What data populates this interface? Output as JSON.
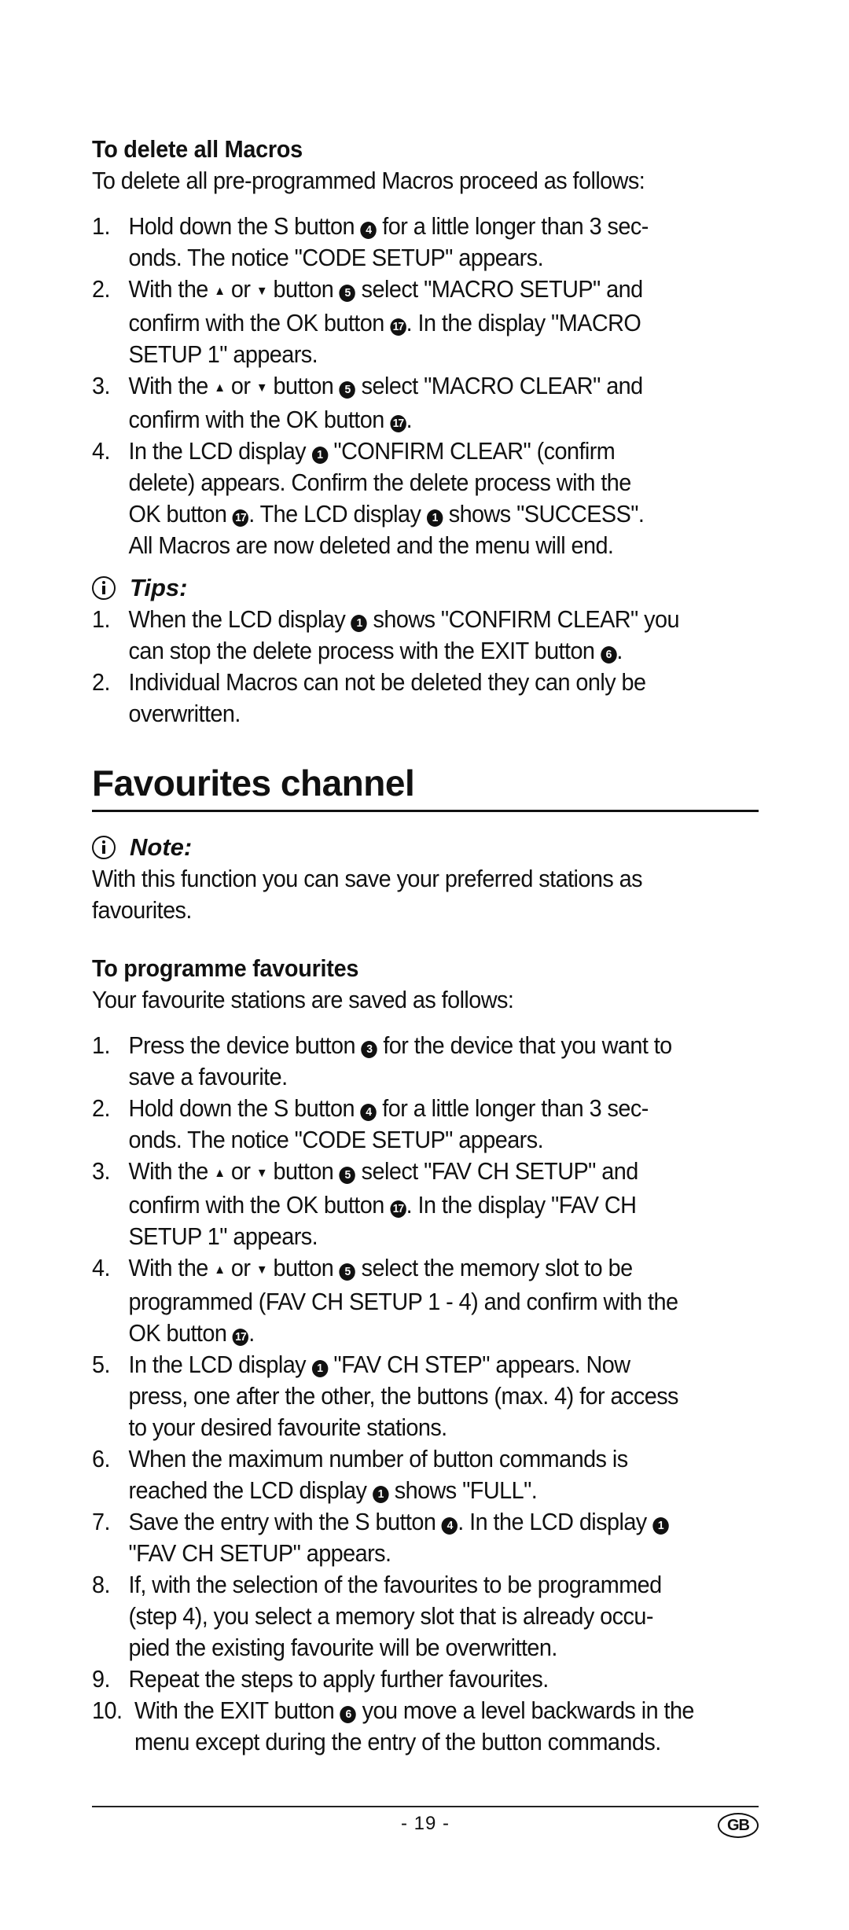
{
  "delete_macros": {
    "heading": "To delete all Macros",
    "intro": "To delete all pre-programmed Macros proceed as follows:",
    "steps": [
      {
        "num": "1.",
        "lines": [
          [
            {
              "t": "Hold down the S button "
            },
            {
              "b": "4"
            },
            {
              "t": " for a little longer than 3 sec-"
            }
          ],
          [
            {
              "t": "onds. The notice \"CODE SETUP\" appears."
            }
          ]
        ]
      },
      {
        "num": "2.",
        "lines": [
          [
            {
              "t": "With the "
            },
            {
              "a": "up"
            },
            {
              "t": " or "
            },
            {
              "a": "down"
            },
            {
              "t": " button "
            },
            {
              "b": "5"
            },
            {
              "t": " select \"MACRO SETUP\" and"
            }
          ],
          [
            {
              "t": "confirm with the OK button "
            },
            {
              "b": "17"
            },
            {
              "t": ". In the display \"MACRO"
            }
          ],
          [
            {
              "t": "SETUP 1\" appears."
            }
          ]
        ]
      },
      {
        "num": "3.",
        "lines": [
          [
            {
              "t": "With the "
            },
            {
              "a": "up"
            },
            {
              "t": " or "
            },
            {
              "a": "down"
            },
            {
              "t": " button "
            },
            {
              "b": "5"
            },
            {
              "t": " select \"MACRO CLEAR\" and"
            }
          ],
          [
            {
              "t": "confirm with the OK button "
            },
            {
              "b": "17"
            },
            {
              "t": "."
            }
          ]
        ]
      },
      {
        "num": "4.",
        "lines": [
          [
            {
              "t": "In the LCD display "
            },
            {
              "b": "1"
            },
            {
              "t": " \"CONFIRM CLEAR\" (confirm"
            }
          ],
          [
            {
              "t": "delete) appears. Confirm the delete process with the"
            }
          ],
          [
            {
              "t": "OK button "
            },
            {
              "b": "17"
            },
            {
              "t": ".  The LCD display "
            },
            {
              "b": "1"
            },
            {
              "t": " shows \"SUCCESS\"."
            }
          ],
          [
            {
              "t": "All Macros are now deleted and the menu will end."
            }
          ]
        ]
      }
    ]
  },
  "tips": {
    "icon": "info-icon",
    "label": "Tips:",
    "steps": [
      {
        "num": "1.",
        "lines": [
          [
            {
              "t": "When the LCD display "
            },
            {
              "b": "1"
            },
            {
              "t": " shows \"CONFIRM CLEAR\" you"
            }
          ],
          [
            {
              "t": "can stop the delete process with the EXIT button "
            },
            {
              "b": "6"
            },
            {
              "t": "."
            }
          ]
        ]
      },
      {
        "num": "2.",
        "lines": [
          [
            {
              "t": "Individual Macros can not be deleted they can only be"
            }
          ],
          [
            {
              "t": "overwritten."
            }
          ]
        ]
      }
    ]
  },
  "favourites": {
    "title": "Favourites channel",
    "note": {
      "icon": "info-icon",
      "label": "Note:",
      "lines": [
        "With this function you can save your preferred stations as",
        "favourites."
      ]
    },
    "programme": {
      "heading": "To programme favourites",
      "intro": "Your favourite stations are saved as follows:",
      "steps": [
        {
          "num": "1.",
          "lines": [
            [
              {
                "t": "Press the device button "
              },
              {
                "b": "3"
              },
              {
                "t": " for the device that you want to"
              }
            ],
            [
              {
                "t": "save a favourite."
              }
            ]
          ]
        },
        {
          "num": "2.",
          "lines": [
            [
              {
                "t": "Hold down the S button "
              },
              {
                "b": "4"
              },
              {
                "t": " for a little longer than 3 sec-"
              }
            ],
            [
              {
                "t": "onds. The notice \"CODE SETUP\" appears."
              }
            ]
          ]
        },
        {
          "num": "3.",
          "lines": [
            [
              {
                "t": "With the "
              },
              {
                "a": "up"
              },
              {
                "t": " or "
              },
              {
                "a": "down"
              },
              {
                "t": " button "
              },
              {
                "b": "5"
              },
              {
                "t": " select \"FAV CH SETUP\" and"
              }
            ],
            [
              {
                "t": "confirm with the OK button "
              },
              {
                "b": "17"
              },
              {
                "t": ". In the display \"FAV CH"
              }
            ],
            [
              {
                "t": "SETUP 1\" appears."
              }
            ]
          ]
        },
        {
          "num": "4.",
          "lines": [
            [
              {
                "t": "With the "
              },
              {
                "a": "up"
              },
              {
                "t": " or "
              },
              {
                "a": "down"
              },
              {
                "t": " button "
              },
              {
                "b": "5"
              },
              {
                "t": " select the memory slot to be"
              }
            ],
            [
              {
                "t": "programmed (FAV CH SETUP 1 - 4) and confirm with the"
              }
            ],
            [
              {
                "t": "OK button "
              },
              {
                "b": "17"
              },
              {
                "t": "."
              }
            ]
          ]
        },
        {
          "num": "5.",
          "lines": [
            [
              {
                "t": "In the LCD display "
              },
              {
                "b": "1"
              },
              {
                "t": " \"FAV CH STEP\" appears. Now"
              }
            ],
            [
              {
                "t": "press, one after the other, the buttons (max. 4) for access"
              }
            ],
            [
              {
                "t": "to your desired favourite stations."
              }
            ]
          ]
        },
        {
          "num": "6.",
          "lines": [
            [
              {
                "t": "When the maximum number of button commands is"
              }
            ],
            [
              {
                "t": "reached the LCD display "
              },
              {
                "b": "1"
              },
              {
                "t": " shows \"FULL\"."
              }
            ]
          ]
        },
        {
          "num": "7.",
          "lines": [
            [
              {
                "t": "Save the entry with the S button "
              },
              {
                "b": "4"
              },
              {
                "t": ".  In the LCD display "
              },
              {
                "b": "1"
              }
            ],
            [
              {
                "t": "\"FAV CH SETUP\" appears."
              }
            ]
          ]
        },
        {
          "num": "8.",
          "lines": [
            [
              {
                "t": "If, with the selection of the favourites to be programmed"
              }
            ],
            [
              {
                "t": "(step 4), you select a memory slot that is already occu-"
              }
            ],
            [
              {
                "t": "pied the existing favourite will be overwritten."
              }
            ]
          ]
        },
        {
          "num": "9.",
          "lines": [
            [
              {
                "t": "Repeat the steps to apply further favourites."
              }
            ]
          ]
        },
        {
          "num": "10.",
          "lines": [
            [
              {
                "t": "With the EXIT button "
              },
              {
                "b": "6"
              },
              {
                "t": " you move a level backwards in the"
              }
            ],
            [
              {
                "t": "menu except during the entry of the button commands."
              }
            ]
          ]
        }
      ]
    }
  },
  "footer": {
    "page_number": "- 19 -",
    "language_badge": "GB"
  }
}
